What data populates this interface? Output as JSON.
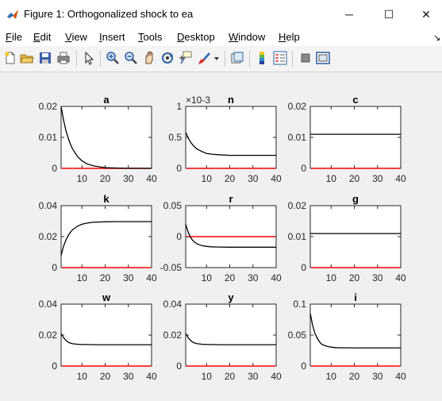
{
  "window": {
    "title": "Figure 1: Orthogonalized shock to ea",
    "minimize_glyph": "─",
    "maximize_glyph": "☐",
    "close_glyph": "✕",
    "icon": "matlab-logo-icon"
  },
  "menu": {
    "items": [
      {
        "pre": "",
        "ul": "F",
        "post": "ile"
      },
      {
        "pre": "",
        "ul": "E",
        "post": "dit"
      },
      {
        "pre": "",
        "ul": "V",
        "post": "iew"
      },
      {
        "pre": "",
        "ul": "I",
        "post": "nsert"
      },
      {
        "pre": "",
        "ul": "T",
        "post": "ools"
      },
      {
        "pre": "",
        "ul": "D",
        "post": "esktop"
      },
      {
        "pre": "",
        "ul": "W",
        "post": "indow"
      },
      {
        "pre": "",
        "ul": "H",
        "post": "elp"
      }
    ],
    "overflow_glyph": "↘"
  },
  "toolbar": {
    "icons": [
      "new-figure-icon",
      "open-file-icon",
      "save-icon",
      "print-icon",
      "select-arrow-icon",
      "zoom-in-icon",
      "zoom-out-icon",
      "pan-hand-icon",
      "rotate-3d-icon",
      "data-cursor-icon",
      "brush-icon",
      "brush-dropdown-icon",
      "link-plot-icon",
      "colorbar-icon",
      "legend-icon",
      "hide-plot-tools-icon",
      "show-plot-tools-icon"
    ]
  },
  "colors": {
    "response_line": "#000000",
    "zero_line": "#ff0000",
    "axes_background": "#ffffff"
  },
  "chart_data": [
    {
      "type": "line",
      "title": "a",
      "xlim": [
        1,
        40
      ],
      "ylim": [
        0,
        0.02
      ],
      "yticks": [
        "0",
        "0.01",
        "0.02"
      ],
      "yticks_values": [
        0,
        0.01,
        0.02
      ],
      "xticks": [
        "10",
        "20",
        "30",
        "40"
      ],
      "xticks_values": [
        10,
        20,
        30,
        40
      ],
      "exponent_label": "",
      "series": [
        {
          "x": [
            1,
            2,
            3,
            4,
            5,
            6,
            8,
            10,
            12,
            15,
            20,
            25,
            30,
            40
          ],
          "y": [
            0.02,
            0.0158,
            0.0125,
            0.0099,
            0.0078,
            0.0062,
            0.0039,
            0.0024,
            0.0015,
            0.0008,
            0.0002,
            0.0001,
            0.0,
            0.0
          ]
        }
      ],
      "zero_line": 0
    },
    {
      "type": "line",
      "title": "n",
      "xlim": [
        1,
        40
      ],
      "ylim": [
        0,
        1
      ],
      "yticks": [
        "0",
        "0.5",
        "1"
      ],
      "yticks_values": [
        0,
        0.5,
        1
      ],
      "xticks": [
        "10",
        "20",
        "30",
        "40"
      ],
      "xticks_values": [
        10,
        20,
        30,
        40
      ],
      "exponent_label": "×10-3",
      "series": [
        {
          "x": [
            1,
            2,
            3,
            4,
            5,
            6,
            8,
            10,
            12,
            15,
            20,
            25,
            30,
            40
          ],
          "y": [
            0.58,
            0.5,
            0.43,
            0.38,
            0.34,
            0.31,
            0.27,
            0.24,
            0.23,
            0.22,
            0.21,
            0.21,
            0.21,
            0.21
          ]
        }
      ],
      "zero_line": 0
    },
    {
      "type": "line",
      "title": "c",
      "xlim": [
        1,
        40
      ],
      "ylim": [
        0,
        0.02
      ],
      "yticks": [
        "0",
        "0.01",
        "0.02"
      ],
      "yticks_values": [
        0,
        0.01,
        0.02
      ],
      "xticks": [
        "10",
        "20",
        "30",
        "40"
      ],
      "xticks_values": [
        10,
        20,
        30,
        40
      ],
      "exponent_label": "",
      "series": [
        {
          "x": [
            1,
            40
          ],
          "y": [
            0.011,
            0.011
          ]
        }
      ],
      "zero_line": 0
    },
    {
      "type": "line",
      "title": "k",
      "xlim": [
        1,
        40
      ],
      "ylim": [
        0,
        0.04
      ],
      "yticks": [
        "0",
        "0.02",
        "0.04"
      ],
      "yticks_values": [
        0,
        0.02,
        0.04
      ],
      "xticks": [
        "10",
        "20",
        "30",
        "40"
      ],
      "xticks_values": [
        10,
        20,
        30,
        40
      ],
      "exponent_label": "",
      "series": [
        {
          "x": [
            1,
            2,
            3,
            4,
            5,
            6,
            8,
            10,
            12,
            15,
            20,
            25,
            30,
            40
          ],
          "y": [
            0.008,
            0.0135,
            0.0175,
            0.0205,
            0.0228,
            0.0245,
            0.0267,
            0.028,
            0.0287,
            0.0293,
            0.0296,
            0.0297,
            0.0297,
            0.0297
          ]
        }
      ],
      "zero_line": 0
    },
    {
      "type": "line",
      "title": "r",
      "xlim": [
        1,
        40
      ],
      "ylim": [
        -0.05,
        0.05
      ],
      "yticks": [
        "-0.05",
        "0",
        "0.05"
      ],
      "yticks_values": [
        -0.05,
        0,
        0.05
      ],
      "xticks": [
        "10",
        "20",
        "30",
        "40"
      ],
      "xticks_values": [
        10,
        20,
        30,
        40
      ],
      "exponent_label": "",
      "series": [
        {
          "x": [
            1,
            2,
            3,
            4,
            5,
            6,
            8,
            10,
            12,
            15,
            20,
            25,
            30,
            40
          ],
          "y": [
            0.02,
            0.008,
            -0.0005,
            -0.006,
            -0.0095,
            -0.0118,
            -0.0145,
            -0.0158,
            -0.0164,
            -0.0168,
            -0.017,
            -0.017,
            -0.017,
            -0.017
          ]
        }
      ],
      "zero_line": 0
    },
    {
      "type": "line",
      "title": "g",
      "xlim": [
        1,
        40
      ],
      "ylim": [
        0,
        0.02
      ],
      "yticks": [
        "0",
        "0.01",
        "0.02"
      ],
      "yticks_values": [
        0,
        0.01,
        0.02
      ],
      "xticks": [
        "10",
        "20",
        "30",
        "40"
      ],
      "xticks_values": [
        10,
        20,
        30,
        40
      ],
      "exponent_label": "",
      "series": [
        {
          "x": [
            1,
            40
          ],
          "y": [
            0.011,
            0.011
          ]
        }
      ],
      "zero_line": 0
    },
    {
      "type": "line",
      "title": "w",
      "xlim": [
        1,
        40
      ],
      "ylim": [
        0,
        0.04
      ],
      "yticks": [
        "0",
        "0.02",
        "0.04"
      ],
      "yticks_values": [
        0,
        0.02,
        0.04
      ],
      "xticks": [
        "10",
        "20",
        "30",
        "40"
      ],
      "xticks_values": [
        10,
        20,
        30,
        40
      ],
      "exponent_label": "",
      "series": [
        {
          "x": [
            1,
            2,
            3,
            4,
            5,
            6,
            8,
            10,
            12,
            15,
            20,
            25,
            30,
            40
          ],
          "y": [
            0.021,
            0.0185,
            0.0167,
            0.0155,
            0.0148,
            0.0144,
            0.0141,
            0.0139,
            0.0139,
            0.0138,
            0.0138,
            0.0138,
            0.0138,
            0.0138
          ]
        }
      ],
      "zero_line": 0
    },
    {
      "type": "line",
      "title": "y",
      "xlim": [
        1,
        40
      ],
      "ylim": [
        0,
        0.04
      ],
      "yticks": [
        "0",
        "0.02",
        "0.04"
      ],
      "yticks_values": [
        0,
        0.02,
        0.04
      ],
      "xticks": [
        "10",
        "20",
        "30",
        "40"
      ],
      "xticks_values": [
        10,
        20,
        30,
        40
      ],
      "exponent_label": "",
      "series": [
        {
          "x": [
            1,
            2,
            3,
            4,
            5,
            6,
            8,
            10,
            12,
            15,
            20,
            25,
            30,
            40
          ],
          "y": [
            0.021,
            0.0185,
            0.0167,
            0.0155,
            0.0148,
            0.0144,
            0.0141,
            0.0139,
            0.0139,
            0.0138,
            0.0138,
            0.0138,
            0.0138,
            0.0138
          ]
        }
      ],
      "zero_line": 0
    },
    {
      "type": "line",
      "title": "i",
      "xlim": [
        1,
        40
      ],
      "ylim": [
        0,
        0.1
      ],
      "yticks": [
        "0",
        "0.05",
        "0.1"
      ],
      "yticks_values": [
        0,
        0.05,
        0.1
      ],
      "xticks": [
        "10",
        "20",
        "30",
        "40"
      ],
      "xticks_values": [
        10,
        20,
        30,
        40
      ],
      "exponent_label": "",
      "series": [
        {
          "x": [
            1,
            2,
            3,
            4,
            5,
            6,
            8,
            10,
            12,
            15,
            20,
            25,
            30,
            40
          ],
          "y": [
            0.085,
            0.066,
            0.053,
            0.045,
            0.039,
            0.035,
            0.032,
            0.0305,
            0.0298,
            0.0295,
            0.0293,
            0.0293,
            0.0293,
            0.0293
          ]
        }
      ],
      "zero_line": 0
    }
  ]
}
